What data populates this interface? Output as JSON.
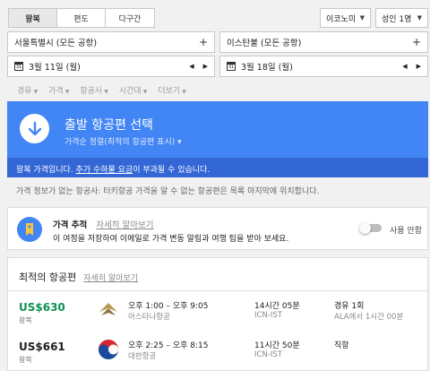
{
  "trip_types": [
    "왕복",
    "편도",
    "다구간"
  ],
  "cabin": "이코노미",
  "passengers": "성인 1명",
  "origin": "서울특별시 (모든 공항)",
  "destination": "이스탄불 (모든 공항)",
  "depart_date": "3월 11일 (월)",
  "return_date": "3월 18일 (월)",
  "calendar_icon_text": "31",
  "filters": [
    "경유",
    "가격",
    "항공사",
    "시간대",
    "더보기"
  ],
  "hero": {
    "title": "출발 항공편 선택",
    "subtitle": "가격순 정렬(최적의 항공편 표시)"
  },
  "notice": {
    "prefix": "왕복 가격입니다. ",
    "link": "추가 수하물 요금",
    "suffix": "이 부과될 수 있습니다."
  },
  "info_text": "가격 정보가 없는 항공사: 터키항공 가격을 알 수 없는 항공편은 목록 마지막에 위치합니다.",
  "tracking": {
    "title": "가격 추적",
    "more": "자세히 알아보기",
    "desc": "이 여정을 저장하여 이메일로 가격 변동 알림과 여행 팁을 받아 보세요.",
    "toggle_label": "사용 안함"
  },
  "best_flights": {
    "title": "최적의 항공편",
    "more": "자세히 알아보기",
    "flights": [
      {
        "price": "US$630",
        "price_color": "#0d904f",
        "kind": "왕복",
        "times": "오후 1:00 – 오후 9:05",
        "airline": "아스타나항공",
        "duration": "14시간 05분",
        "route": "ICN-IST",
        "stops": "경유 1회",
        "stop_detail": "ALA에서 1시간 00분"
      },
      {
        "price": "US$661",
        "price_color": "#212121",
        "kind": "왕복",
        "times": "오후 2:25 – 오후 8:15",
        "airline": "대한항공",
        "duration": "11시간 50분",
        "route": "ICN-IST",
        "stops": "직항",
        "stop_detail": ""
      }
    ]
  }
}
